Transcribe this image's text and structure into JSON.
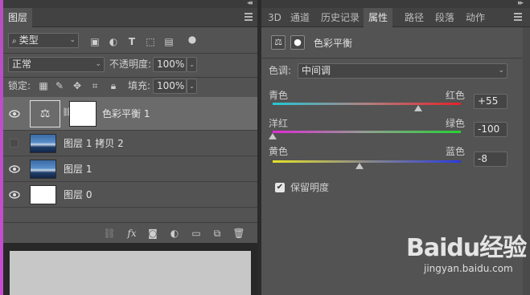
{
  "layers_panel": {
    "tab": "图层",
    "filter_kind": "类型",
    "blend_mode": "正常",
    "opacity_label": "不透明度:",
    "opacity_value": "100%",
    "lock_label": "锁定:",
    "fill_label": "填充:",
    "fill_value": "100%",
    "layers": [
      {
        "name": "色彩平衡 1",
        "visible": true,
        "selected": true
      },
      {
        "name": "图层 1 拷贝 2",
        "visible": false,
        "selected": false
      },
      {
        "name": "图层 1",
        "visible": true,
        "selected": false
      },
      {
        "name": "图层 0",
        "visible": true,
        "selected": false
      }
    ],
    "footer_fx": "fx"
  },
  "right_panel": {
    "tabs": [
      "3D",
      "通道",
      "历史记录",
      "属性",
      "路径",
      "段落",
      "动作"
    ],
    "active_tab": "属性"
  },
  "properties": {
    "title": "色彩平衡",
    "tone_label": "色调:",
    "tone_value": "中间调",
    "sliders": [
      {
        "left": "青色",
        "right": "红色",
        "value": "+55",
        "fraction": 0.775
      },
      {
        "left": "洋红",
        "right": "绿色",
        "value": "-100",
        "fraction": 0.0
      },
      {
        "left": "黄色",
        "right": "蓝色",
        "value": "-8",
        "fraction": 0.46
      }
    ],
    "preserve_label": "保留明度",
    "preserve_checked": true
  },
  "watermark": {
    "brand": "Baidu经验",
    "url": "jingyan.baidu.com"
  },
  "colors": {
    "panel_bg": "#535353",
    "tab_bar_bg": "#424242",
    "selected_layer_bg": "#6b6b6b",
    "canvas_bg": "#282828"
  }
}
